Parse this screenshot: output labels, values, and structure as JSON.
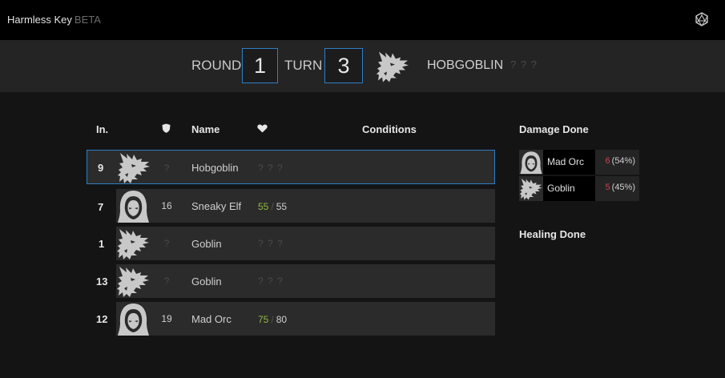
{
  "app": {
    "title": "Harmless Key",
    "badge": "BETA",
    "dice_icon": "d20-dice-icon"
  },
  "turn_bar": {
    "round_label": "ROUND",
    "round_value": "1",
    "turn_label": "TURN",
    "turn_value": "3",
    "current_name": "HOBGOBLIN",
    "current_hp": "? ? ?"
  },
  "table": {
    "headers": {
      "initiative": "In.",
      "armor_icon": "shield-icon",
      "name": "Name",
      "hp_icon": "heart-icon",
      "conditions": "Conditions"
    },
    "rows": [
      {
        "initiative": "9",
        "avatar": "dragon-icon",
        "ac": "?",
        "name": "Hobgoblin",
        "hp_unknown": "? ? ?",
        "active": true
      },
      {
        "initiative": "7",
        "avatar": "hooded-figure-icon",
        "ac": "16",
        "name": "Sneaky Elf",
        "hp_current": "55",
        "hp_sep": "/",
        "hp_max": "55"
      },
      {
        "initiative": "1",
        "avatar": "dragon-icon",
        "ac": "?",
        "name": "Goblin",
        "hp_unknown": "? ? ?"
      },
      {
        "initiative": "13",
        "avatar": "dragon-icon",
        "ac": "?",
        "name": "Goblin",
        "hp_unknown": "? ? ?"
      },
      {
        "initiative": "12",
        "avatar": "hooded-figure-icon",
        "ac": "19",
        "name": "Mad Orc",
        "hp_current": "75",
        "hp_sep": "/",
        "hp_max": "80"
      }
    ]
  },
  "damage_done": {
    "title": "Damage Done",
    "entries": [
      {
        "avatar": "hooded-figure-icon",
        "name": "Mad Orc",
        "value": "6",
        "percent": "(54%)"
      },
      {
        "avatar": "dragon-icon",
        "name": "Goblin",
        "value": "5",
        "percent": "(45%)"
      }
    ]
  },
  "healing_done": {
    "title": "Healing Done"
  },
  "colors": {
    "accent": "#2f7fc6",
    "hp_green": "#8dbb3e",
    "damage_red": "#c9444f"
  }
}
